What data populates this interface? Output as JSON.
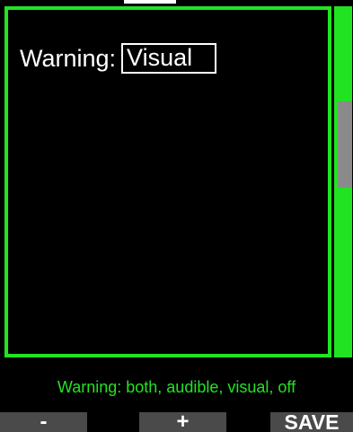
{
  "screen": {
    "field_label": "Warning:",
    "field_value": "Visual",
    "status_text": "Warning: both, audible, visual, off"
  },
  "softkeys": {
    "left_label": "-",
    "center_label": "+",
    "right_label": "SAVE"
  },
  "colors": {
    "accent_green": "#22e322",
    "background": "#000000",
    "text": "#ffffff",
    "softkey_bg": "#4a4a4a",
    "scroll_thumb": "#8a8a8a"
  }
}
